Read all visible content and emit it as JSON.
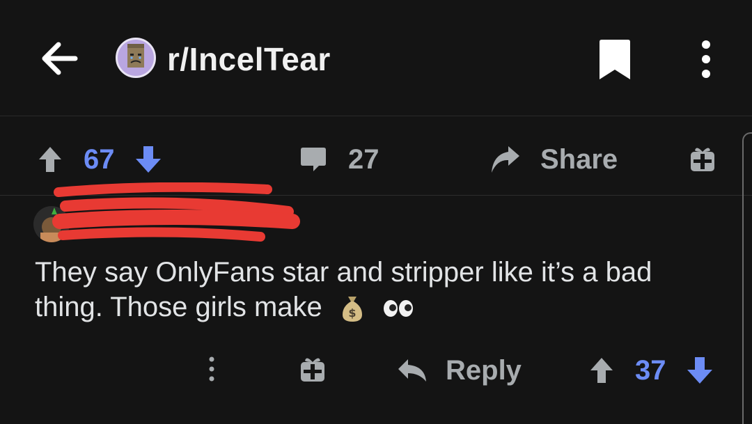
{
  "header": {
    "subreddit": "r/IncelTear",
    "back_icon": "arrow-left-icon",
    "bookmark_icon": "bookmark-icon",
    "more_icon": "more-vertical-icon"
  },
  "post_actions": {
    "score": "67",
    "comment_count": "27",
    "share_label": "Share"
  },
  "comment": {
    "text": "They say OnlyFans star and stripper like it’s a bad thing. Those girls make",
    "emoji": [
      "money-bag",
      "eyes"
    ],
    "reply_label": "Reply",
    "score": "37"
  },
  "colors": {
    "background": "#141414",
    "upvote_blue": "#6c8cf5",
    "icon_grey": "#a8acaf",
    "redaction_red": "#e83a33"
  }
}
